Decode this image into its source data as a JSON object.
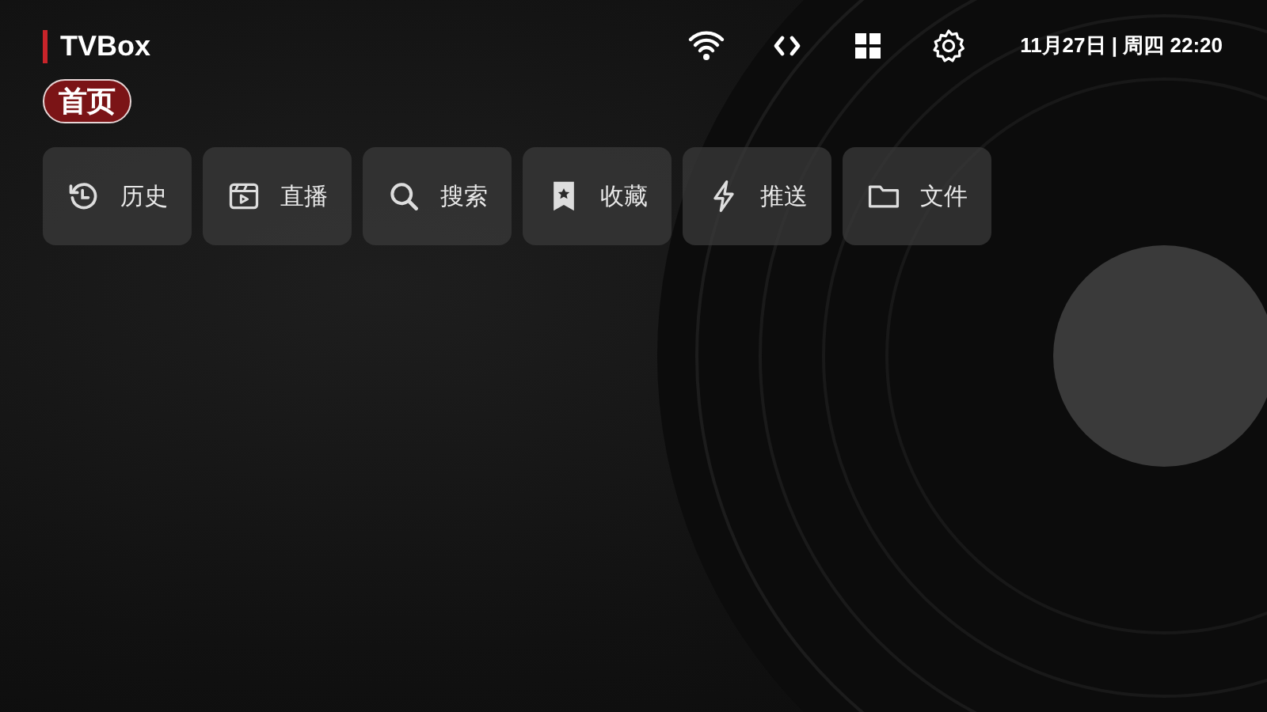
{
  "app": {
    "title": "TVBox"
  },
  "tabs": [
    {
      "label": "首页",
      "selected": true
    }
  ],
  "toolbar": [
    {
      "kind": "wifi"
    },
    {
      "kind": "code"
    },
    {
      "kind": "grid"
    },
    {
      "kind": "settings"
    }
  ],
  "status": {
    "datetime": "11月27日 | 周四 22:20"
  },
  "shortcuts": [
    {
      "kind": "history",
      "label": "历史"
    },
    {
      "kind": "live",
      "label": "直播"
    },
    {
      "kind": "search",
      "label": "搜索"
    },
    {
      "kind": "favorites",
      "label": "收藏"
    },
    {
      "kind": "push",
      "label": "推送"
    },
    {
      "kind": "files",
      "label": "文件"
    }
  ]
}
